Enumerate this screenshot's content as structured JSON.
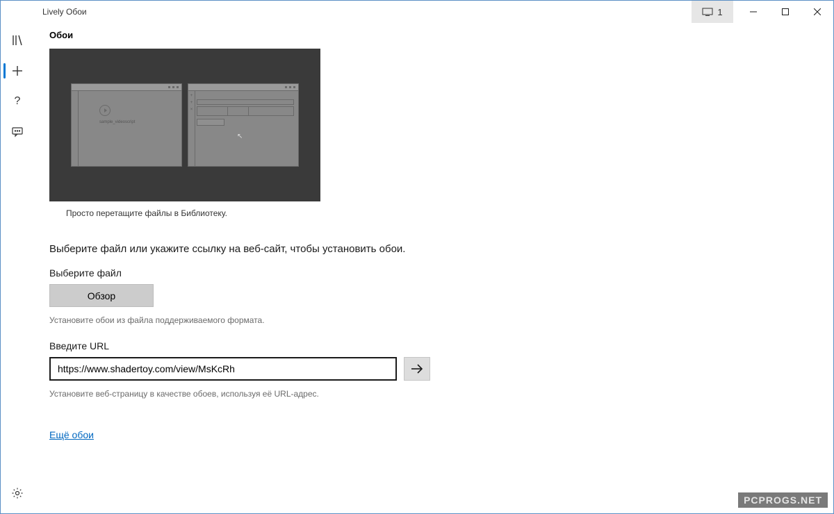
{
  "window": {
    "title": "Lively Обои",
    "display_badge": "1"
  },
  "sidebar": {
    "icons": [
      "library",
      "add",
      "help",
      "feedback"
    ],
    "bottom_icon": "settings"
  },
  "main": {
    "section_title": "Обои",
    "preview_caption": "Просто перетащите файлы в Библиотеку.",
    "mini_label": "sample_videoscript",
    "instruction": "Выберите файл или укажите ссылку на веб-сайт, чтобы установить обои.",
    "file": {
      "label": "Выберите файл",
      "button": "Обзор",
      "helper": "Установите обои из файла поддерживаемого формата."
    },
    "url": {
      "label": "Введите URL",
      "value": "https://www.shadertoy.com/view/MsKcRh",
      "helper": "Установите веб-страницу в качестве обоев, используя её URL-адрес."
    },
    "more_link": "Ещё обои"
  },
  "watermark": "PCPROGS.NET"
}
